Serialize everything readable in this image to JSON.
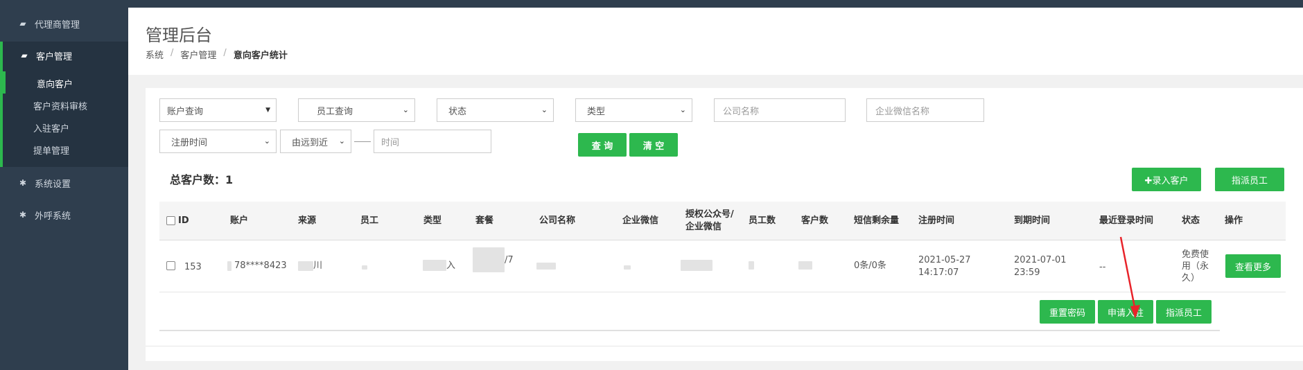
{
  "sidebar": {
    "items": [
      {
        "label": "代理商管理",
        "icon": "book-icon"
      },
      {
        "label": "客户管理",
        "icon": "book-icon"
      },
      {
        "label": "系统设置",
        "icon": "gear-icon"
      },
      {
        "label": "外呼系统",
        "icon": "gear-icon"
      }
    ],
    "sub_items": [
      "意向客户",
      "客户资料审核",
      "入驻客户",
      "提单管理"
    ]
  },
  "header": {
    "title": "管理后台",
    "breadcrumb": [
      "系统",
      "客户管理",
      "意向客户统计"
    ]
  },
  "filters": {
    "account_query": "账户查询",
    "staff_query": "员工查询",
    "status": "状态",
    "type": "类型",
    "company_placeholder": "公司名称",
    "wechat_placeholder": "企业微信名称",
    "reg_time": "注册时间",
    "order": "由远到近",
    "time_placeholder": "时间",
    "query_button": "查 询",
    "clear_button": "清 空"
  },
  "summary": {
    "total_label": "总客户数：1",
    "add_button": "✚录入客户",
    "assign_button": "指派员工"
  },
  "table": {
    "headers": [
      "ID",
      "账户",
      "来源",
      "员工",
      "类型",
      "套餐",
      "公司名称",
      "企业微信",
      "授权公众号/企业微信",
      "员工数",
      "客户数",
      "短信剩余量",
      "注册时间",
      "到期时间",
      "最近登录时间",
      "状态",
      "操作"
    ],
    "row": {
      "id": "153",
      "account": "78****8423",
      "source_partial": "川",
      "type_partial": "入",
      "package_partial": "/7",
      "sms": "0条/0条",
      "reg_date": "2021-05-27",
      "reg_time": "14:17:07",
      "exp_date": "2021-07-01",
      "exp_time": "23:59",
      "last_login": "--",
      "status": "免费使用（永久）",
      "more_button": "查看更多"
    },
    "row_actions": [
      "重置密码",
      "申请入驻",
      "指派员工"
    ]
  },
  "colors": {
    "sidebar_bg": "#2f3e4e",
    "accent_green": "#2db84e",
    "annotation_red": "#e8232a"
  }
}
